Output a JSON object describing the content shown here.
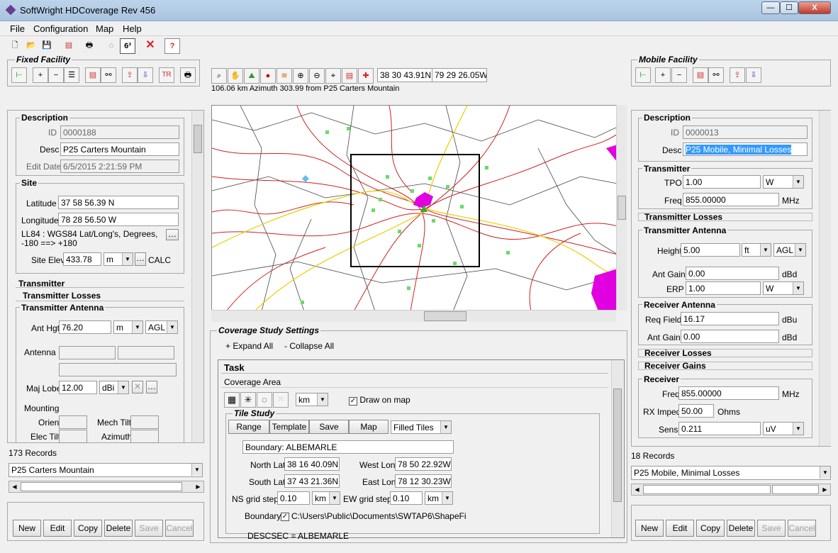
{
  "window": {
    "title": "SoftWright HDCoverage Rev 456",
    "minimize": "—",
    "maximize": "☐",
    "close": "X"
  },
  "menu": [
    "File",
    "Configuration",
    "Map",
    "Help"
  ],
  "fixed_facility": {
    "title": "Fixed Facility",
    "description": {
      "header": "Description",
      "id_label": "ID",
      "id": "0000188",
      "desc_label": "Desc",
      "desc": "P25 Carters Mountain",
      "editdate_label": "Edit Date",
      "edit_date": "6/5/2015 2:21:59 PM"
    },
    "site": {
      "header": "Site",
      "lat_label": "Latitude",
      "latitude": "37 58 56.39 N",
      "lon_label": "Longitude",
      "longitude": "78 28 56.50 W",
      "datum": "LL84 : WGS84 Lat/Long's, Degrees, -180 ==> +180",
      "elev_label": "Site Elev",
      "elev": "433.78",
      "elev_unit": "m",
      "calc": "CALC"
    },
    "transmitter": "Transmitter",
    "transmitter_losses": "Transmitter Losses",
    "tx_antenna": {
      "header": "Transmitter Antenna",
      "hgt_label": "Ant Hgt",
      "hgt": "76.20",
      "hgt_unit": "m",
      "ref": "AGL",
      "antenna_label": "Antenna",
      "majlobe_label": "Maj Lobe",
      "majlobe": "12.00",
      "majlobe_unit": "dBi",
      "mounting": "Mounting",
      "orient": "Orient",
      "mechtilt": "Mech Tilt",
      "electilt": "Elec Tilt",
      "azimuth": "Azimuth"
    },
    "records": "173 Records",
    "selected": "P25 Carters Mountain",
    "buttons": [
      "New",
      "Edit",
      "Copy",
      "Delete",
      "Save",
      "Cancel"
    ]
  },
  "map_toolbar": {
    "lat": "38 30 43.91N",
    "lon": "79 29 26.05W",
    "status": "106.06 km Azimuth 303.99 from P25 Carters Mountain"
  },
  "coverage": {
    "title": "Coverage Study Settings",
    "expand": "+ Expand All",
    "collapse": "- Collapse All",
    "task": "Task",
    "coverage_area": "Coverage Area",
    "units": "km",
    "draw_on_map": "Draw on map",
    "tile_study": "Tile Study",
    "tabs": [
      "Range",
      "Template",
      "Save",
      "Map"
    ],
    "tile_mode": "Filled Tiles",
    "boundary_name": "Boundary: ALBEMARLE",
    "north_lat_label": "North Lat",
    "north_lat": "38 16 40.09N",
    "west_lon_label": "West Lon",
    "west_lon": "78 50 22.92W",
    "south_lat_label": "South Lat",
    "south_lat": "37 43 21.36N",
    "east_lon_label": "East Lon",
    "east_lon": "78 12 30.23W",
    "ns_label": "NS grid step:",
    "ns": "0.10",
    "ns_unit": "km",
    "ew_label": "EW grid step:",
    "ew": "0.10",
    "ew_unit": "km",
    "boundary_label": "Boundary",
    "boundary_path": "C:\\Users\\Public\\Documents\\SWTAP6\\ShapeFi",
    "descsec": "DESCSEC = ALBEMARLE"
  },
  "mobile_facility": {
    "title": "Mobile Facility",
    "description": {
      "header": "Description",
      "id_label": "ID",
      "id": "0000013",
      "desc_label": "Desc",
      "desc": "P25 Mobile, Minimal Losses"
    },
    "transmitter": {
      "header": "Transmitter",
      "tpo_label": "TPO",
      "tpo": "1.00",
      "tpo_unit": "W",
      "freq_label": "Freq",
      "freq": "855.00000",
      "freq_unit": "MHz"
    },
    "transmitter_losses": "Transmitter Losses",
    "tx_antenna": {
      "header": "Transmitter Antenna",
      "height_label": "Height",
      "height": "5.00",
      "height_unit": "ft",
      "ref": "AGL",
      "gain_label": "Ant Gain",
      "gain": "0.00",
      "gain_unit": "dBd",
      "erp_label": "ERP",
      "erp": "1.00",
      "erp_unit": "W"
    },
    "rx_antenna": {
      "header": "Receiver Antenna",
      "reqfield_label": "Req Field",
      "reqfield": "16.17",
      "reqfield_unit": "dBu",
      "gain_label": "Ant Gain",
      "gain": "0.00",
      "gain_unit": "dBd"
    },
    "receiver_losses": "Receiver Losses",
    "receiver_gains": "Receiver Gains",
    "receiver": {
      "header": "Receiver",
      "freq_label": "Freq",
      "freq": "855.00000",
      "freq_unit": "MHz",
      "imped_label": "RX Imped",
      "imped": "50.00",
      "imped_unit": "Ohms",
      "sens_label": "Sens",
      "sens": "0.211",
      "sens_unit": "uV"
    },
    "records": "18 Records",
    "selected": "P25 Mobile, Minimal Losses",
    "buttons": [
      "New",
      "Edit",
      "Copy",
      "Delete",
      "Save",
      "Cancel"
    ]
  },
  "colors": {
    "selection": "#3399ff",
    "coverage_fill": "#e000e0",
    "road_red": "#cc2222",
    "road_yellow": "#e8d000",
    "boundary": "#444444",
    "point_green": "#66dd66"
  }
}
